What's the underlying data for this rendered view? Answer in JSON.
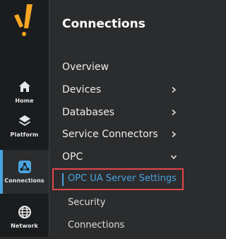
{
  "brand": {
    "icon": "exclamation-logo-icon",
    "accent": "#f6a623"
  },
  "rail": {
    "items": [
      {
        "label": "Home",
        "icon": "home-icon"
      },
      {
        "label": "Platform",
        "icon": "layers-icon"
      },
      {
        "label": "Connections",
        "icon": "connections-icon",
        "active": true
      },
      {
        "label": "Network",
        "icon": "globe-icon"
      }
    ]
  },
  "panel": {
    "title": "Connections",
    "items": [
      {
        "label": "Overview"
      },
      {
        "label": "Devices",
        "chevron": "chevron-right-icon"
      },
      {
        "label": "Databases",
        "chevron": "chevron-right-icon"
      },
      {
        "label": "Service Connectors",
        "chevron": "chevron-right-icon"
      },
      {
        "label": "OPC",
        "chevron": "chevron-down-icon",
        "expanded": true
      }
    ],
    "opc_subitems": [
      {
        "label": "OPC UA Server Settings",
        "selected": true
      },
      {
        "label": "Security"
      },
      {
        "label": "Connections"
      }
    ]
  },
  "colors": {
    "selected": "#4aa3df",
    "highlight_border": "#e2474e"
  }
}
